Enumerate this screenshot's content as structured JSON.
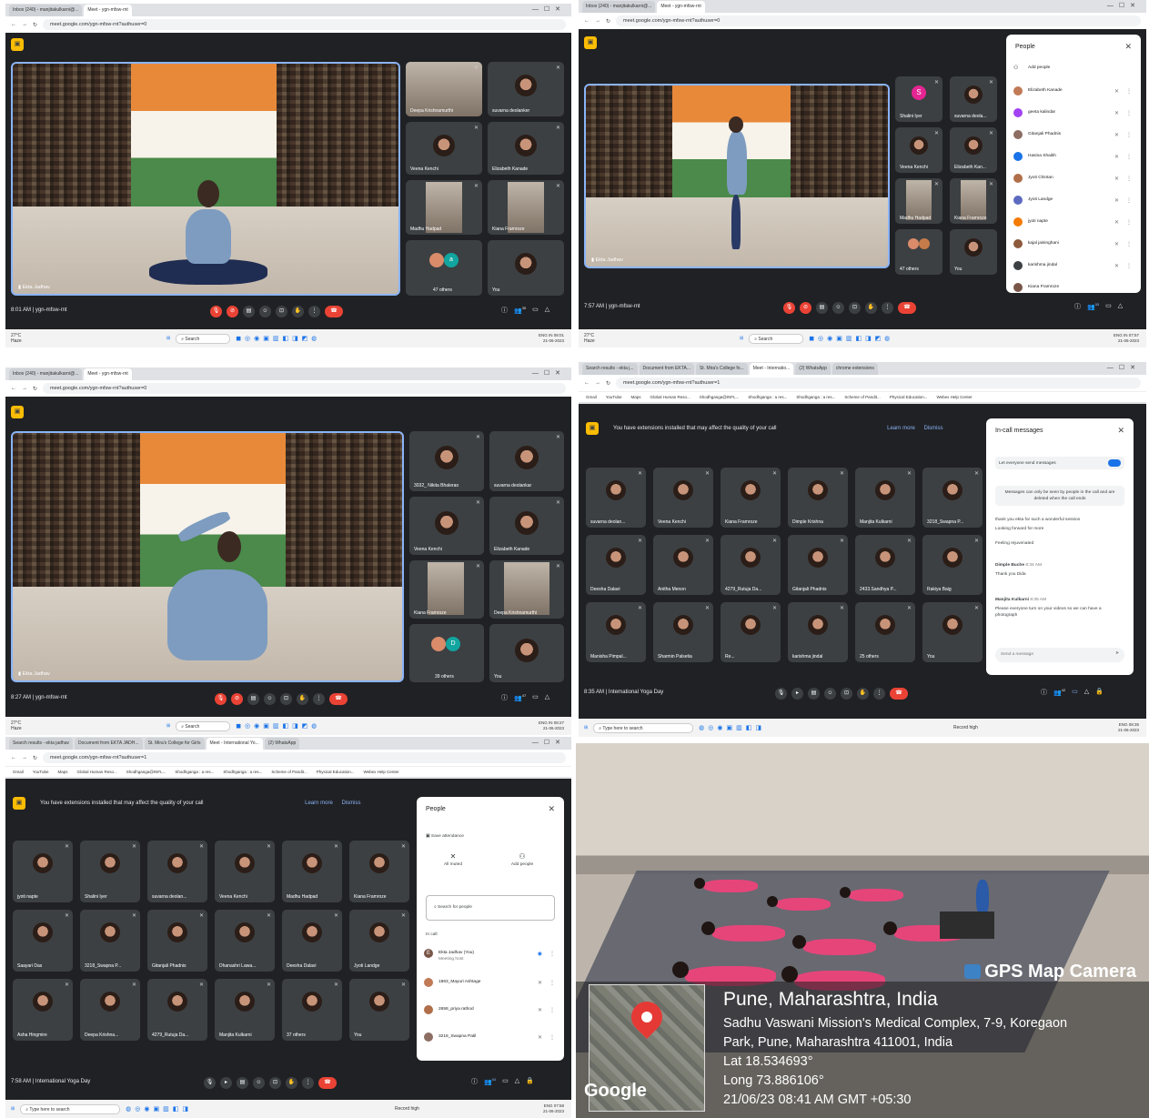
{
  "panel1": {
    "tabs": [
      "Inbox (240) - manjitakulkarni@...",
      "Meet - ygn-mfsw-rnt"
    ],
    "url": "meet.google.com/ygn-mfsw-rnt?authuser=0",
    "stage_name": "Ekta Jadhav",
    "tiles": [
      "Deepa Krishnamurthi",
      "suvarna deolanker",
      "Veena Kenchi",
      "Elizabeth Kanade",
      "Madhu Hadpad",
      "Kiana Framroze",
      "47 others",
      "You"
    ],
    "time": "8:01 AM",
    "separator": "|",
    "meeting": "ygn-mfsw-rnt",
    "people_count": "35",
    "weather_temp": "27°C",
    "weather_desc": "Haze",
    "search": "Search",
    "tray_time": "08:01",
    "tray_date": "21-06-2023",
    "lang": "ENG IN"
  },
  "panel2": {
    "tabs": [
      "Inbox (240) - manjitakulkarni@...",
      "Meet - ygn-mfsw-rnt"
    ],
    "url": "meet.google.com/ygn-mfsw-rnt?authuser=0",
    "stage_name": "Ekta Jadhav",
    "tiles": [
      "Shalini Iyer",
      "suvarna deola...",
      "Veena Kenchi",
      "Elizabeth Kan...",
      "Madhu Hadpad",
      "Kiana Framroze",
      "47 others",
      "You"
    ],
    "side_title": "People",
    "add_people": "Add people",
    "people": [
      "Elizabeth Kanade",
      "geeta kalindar",
      "Gitanjali Phadnis",
      "Hasina Shaikh",
      "Jyoti Chintan",
      "Jyoti Landge",
      "jyoti napte",
      "kajal jaisinghani",
      "karishma jindal",
      "Kiana Framroze"
    ],
    "time": "7:57 AM",
    "separator": "|",
    "meeting": "ygn-mfsw-rnt",
    "people_count": "55",
    "weather_temp": "27°C",
    "weather_desc": "Haze",
    "search": "Search",
    "tray_time": "07:57",
    "tray_date": "21-06-2023",
    "lang": "ENG IN"
  },
  "panel3": {
    "tabs": [
      "Inbox (240) - manjitakulkarni@...",
      "Meet - ygn-mfsw-rnt"
    ],
    "url": "meet.google.com/ygn-mfsw-rnt?authuser=0",
    "stage_name": "Ekta Jadhav",
    "tiles": [
      "3032_ Nikita Bhalerao",
      "suvarna deolankar",
      "Veena Kenchi",
      "Elizabeth Kanade",
      "Kiana Framroze",
      "Deepa Krishnamurthi",
      "39 others",
      "You"
    ],
    "time": "8:27 AM",
    "separator": "|",
    "meeting": "ygn-mfsw-rnt",
    "people_count": "47",
    "weather_temp": "27°C",
    "weather_desc": "Haze",
    "search": "Search",
    "tray_time": "08:27",
    "tray_date": "21-06-2023",
    "lang": "ENG IN"
  },
  "panel4": {
    "tabs": [
      "Search results - ekta j...",
      "Document from EKTA...",
      "St. Mira's College fo...",
      "Meet - Internatio...",
      "(2) WhatsApp",
      "chrome extensions"
    ],
    "url": "meet.google.com/ygn-mfsw-rnt?authuser=1",
    "bookmarks": [
      "Gmail",
      "YouTube",
      "Maps",
      "Global Human Reso...",
      "Shodhganga@INFL...",
      "Shodhganga : a res...",
      "Shodhganga : a res...",
      "Scheme of Pandit...",
      "Physical Education...",
      "Webex Help Center"
    ],
    "banner": "You have extensions installed that may affect the quality of your call",
    "learn_more": "Learn more",
    "dismiss": "Dismiss",
    "tiles": [
      "suvarna deolan...",
      "Veena Kenchi",
      "Kiana Framroze",
      "Dimple Krishna",
      "Manjita Kulkarni",
      "3218_Swapna P...",
      "Deesha Dalavi",
      "Anitha Menon",
      "4279_Rutuja Da...",
      "Gitanjali Phadnis",
      "2433.Sandhya P...",
      "Rakiya Baig",
      "Manisha Pimpal...",
      "Sharmin Palsetia",
      "Re...",
      "karishma jindal",
      "25 others",
      "You"
    ],
    "side_title": "In-call messages",
    "let_everyone": "Let everyone send messages",
    "notice": "Messages can only be seen by people in the call and are deleted when the call ends",
    "messages": [
      "thank you ekta for such a wonderful session",
      "Looking forward for more",
      "Feeling rejuvenated"
    ],
    "msg1_author": "Dimple Buche",
    "msg1_time": "8:34 AM",
    "msg1_text": "Thank you Dida",
    "msg2_author": "Manjita Kulkarni",
    "msg2_time": "8:35 AM",
    "msg2_text": "Please everyone turn on your videos so we can have a photograph",
    "send_placeholder": "Send a message",
    "time": "8:35 AM",
    "separator": "|",
    "meeting": "International Yoga Day",
    "people_count": "42",
    "search": "Type here to search",
    "record": "Record high",
    "tray_time": "08:35",
    "tray_date": "21-06-2023",
    "lang": "ENG"
  },
  "panel5": {
    "tabs": [
      "Search results - ekta jadhav",
      "Document from EKTA JADH...",
      "St. Mira's College for Girls",
      "Meet - International Yo...",
      "(2) WhatsApp"
    ],
    "url": "meet.google.com/ygn-mfsw-rnt?authuser=1",
    "bookmarks": [
      "Gmail",
      "YouTube",
      "Maps",
      "Global Human Reso...",
      "Shodhganga@INFL...",
      "Shodhganga : a res...",
      "Shodhganga : a res...",
      "Scheme of Pandit...",
      "Physical Education...",
      "Webex Help Center"
    ],
    "banner": "You have extensions installed that may affect the quality of your call",
    "learn_more": "Learn more",
    "dismiss": "Dismiss",
    "tiles": [
      "jyoti napte",
      "Shalini Iyer",
      "suvarna deolan...",
      "Veena Kenchi",
      "Madhu Hadpad",
      "Kiana Framroze",
      "Saayari Das",
      "3218_Swapna P...",
      "Gitanjali Phadnis",
      "Dhanashri Lawa...",
      "Deesha Dalavi",
      "Jyoti Landge",
      "Asha Hingmire",
      "Deepa Krishna...",
      "4279_Rutuja Da...",
      "Manjita Kulkarni",
      "37 others",
      "You"
    ],
    "side_title": "People",
    "save_attendance": "Save attendance",
    "all_muted": "All muted",
    "add_people": "Add people",
    "search_people": "Search for people",
    "in_call": "In call",
    "people": [
      "Ekta Jadhav (You)",
      "1863_Mayuri Ashtage",
      "2658_priya rathod",
      "3218_Swapna Patil"
    ],
    "host_label": "Meeting host",
    "time": "7:58 AM",
    "separator": "|",
    "meeting": "International Yoga Day",
    "people_count": "54",
    "search": "Type here to search",
    "record": "Record high",
    "tray_time": "07:58",
    "tray_date": "21-06-2023",
    "lang": "ENG"
  },
  "gps": {
    "brand": "GPS Map Camera",
    "city": "Pune, Maharashtra, India",
    "address1": "Sadhu Vaswani Mission's Medical Complex, 7-9, Koregaon",
    "address2": "Park, Pune, Maharashtra 411001, India",
    "lat": "Lat 18.534693°",
    "long": "Long 73.886106°",
    "datetime": "21/06/23 08:41 AM GMT +05:30",
    "map_logo": "Google"
  },
  "colors": {
    "accent": "#8ab4f8",
    "end_call": "#ea4335",
    "meet_bg": "#202124"
  }
}
